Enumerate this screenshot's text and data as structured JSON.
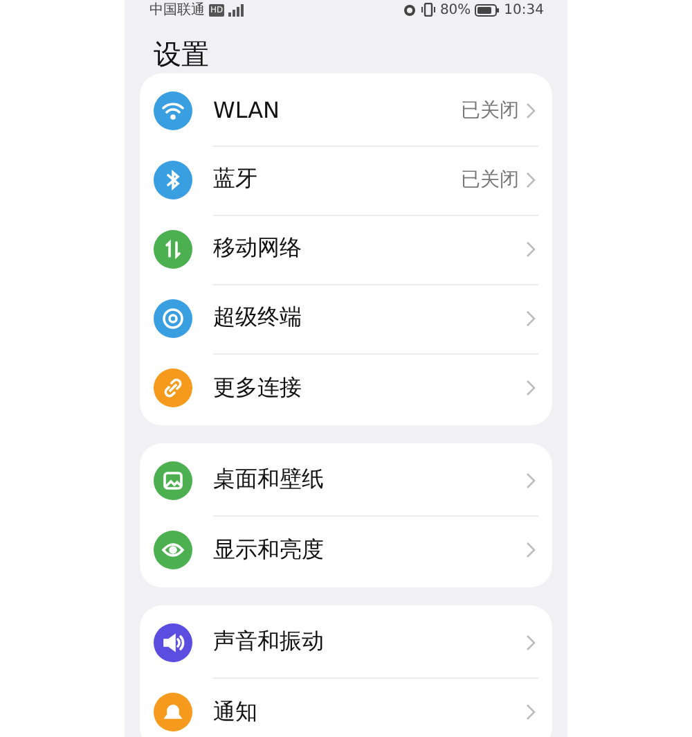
{
  "status_bar": {
    "carrier": "中国联通",
    "network_badge": "HD",
    "battery": "80%",
    "time": "10:34"
  },
  "title": "设置",
  "groups": [
    {
      "items": [
        {
          "label": "WLAN",
          "value": "已关闭",
          "color": "#3a9fe0"
        },
        {
          "label": "蓝牙",
          "value": "已关闭",
          "color": "#3a9fe0"
        },
        {
          "label": "移动网络",
          "color": "#4caf50"
        },
        {
          "label": "超级终端",
          "color": "#3a9fe0"
        },
        {
          "label": "更多连接",
          "color": "#f59a1c"
        }
      ]
    },
    {
      "items": [
        {
          "label": "桌面和壁纸",
          "color": "#4caf50"
        },
        {
          "label": "显示和亮度",
          "color": "#4caf50"
        }
      ]
    },
    {
      "items": [
        {
          "label": "声音和振动",
          "color": "#5a4de0"
        },
        {
          "label": "通知",
          "color": "#f59a1c"
        }
      ]
    }
  ]
}
